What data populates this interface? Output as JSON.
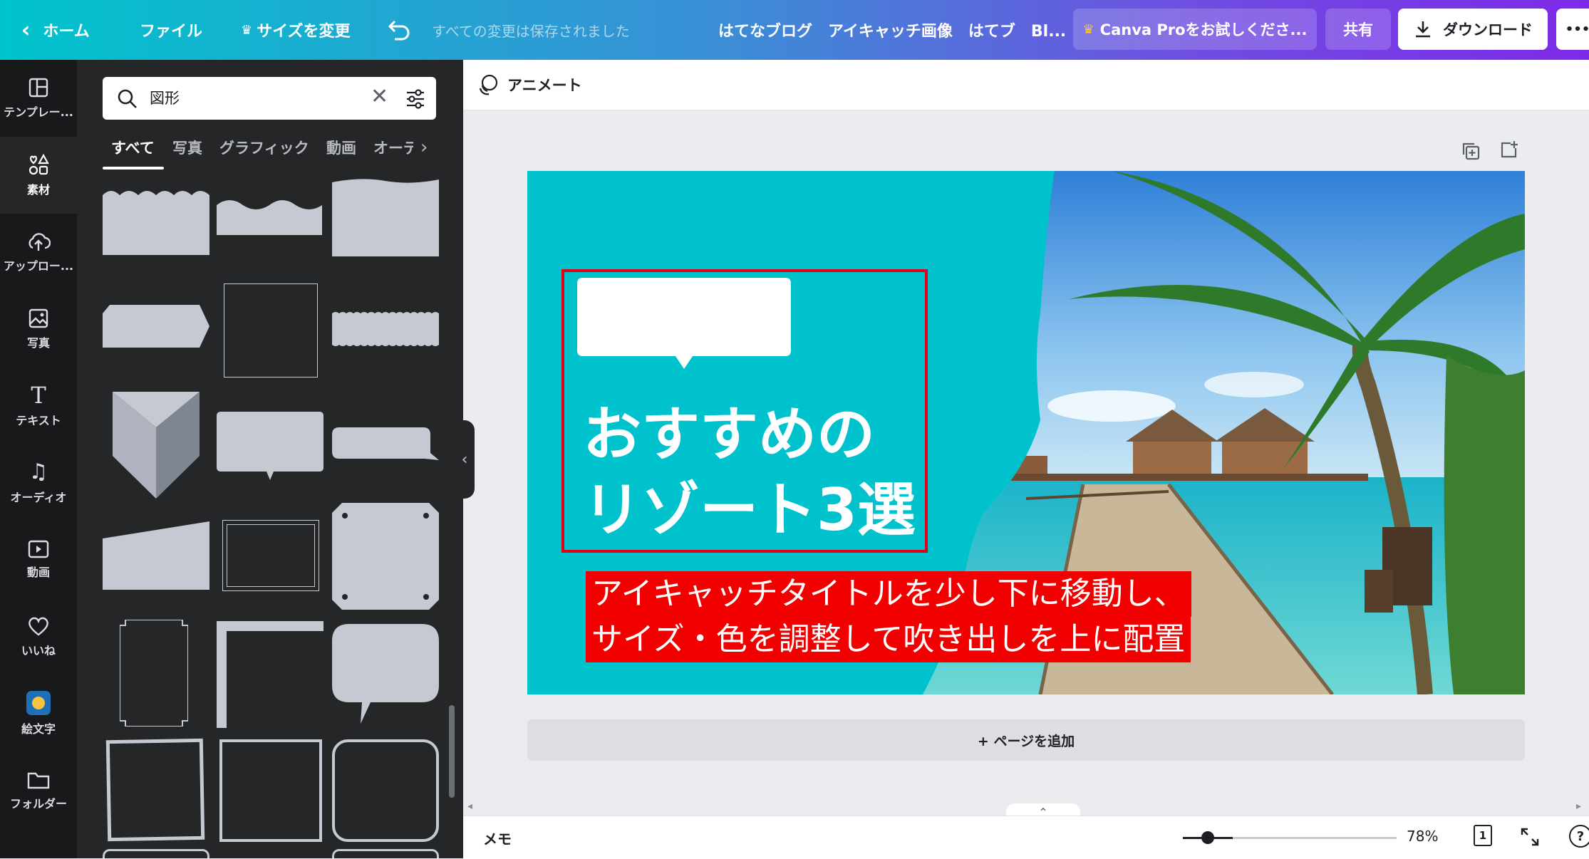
{
  "topbar": {
    "home": "ホーム",
    "file": "ファイル",
    "resize": "サイズを変更",
    "save_status": "すべての変更は保存されました",
    "doc_title": "はてなブログ　アイキャッチ画像　はてブ　Bl...",
    "pro_trial": "Canva Proをお試しくださ...",
    "share": "共有",
    "download": "ダウンロード",
    "more": "•••"
  },
  "rail": [
    {
      "icon": "template-icon",
      "label": "テンプレー..."
    },
    {
      "icon": "elements-icon",
      "label": "素材"
    },
    {
      "icon": "upload-icon",
      "label": "アップロー..."
    },
    {
      "icon": "photo-icon",
      "label": "写真"
    },
    {
      "icon": "text-icon",
      "label": "テキスト"
    },
    {
      "icon": "audio-icon",
      "label": "オーディオ"
    },
    {
      "icon": "video-icon",
      "label": "動画"
    },
    {
      "icon": "heart-icon",
      "label": "いいね"
    },
    {
      "icon": "emoji-icon",
      "label": "絵文字"
    },
    {
      "icon": "folder-icon",
      "label": "フォルダー"
    }
  ],
  "panel": {
    "search_value": "図形",
    "tabs": [
      "すべて",
      "写真",
      "グラフィック",
      "動画",
      "オーデ"
    ]
  },
  "toolbar": {
    "animate": "アニメート"
  },
  "design": {
    "title_line1": "おすすめの",
    "title_line2": "リゾート3選",
    "annotation_line1": "アイキャッチタイトルを少し下に移動し、",
    "annotation_line2": "サイズ・色を調整して吹き出しを上に配置"
  },
  "add_page": "+ ページを追加",
  "bottom": {
    "memo": "メモ",
    "zoom": "78%",
    "page_num": "1"
  },
  "colors": {
    "teal": "#00c2cc",
    "purple": "#7d2ae8",
    "annotation_red": "#f20000"
  }
}
